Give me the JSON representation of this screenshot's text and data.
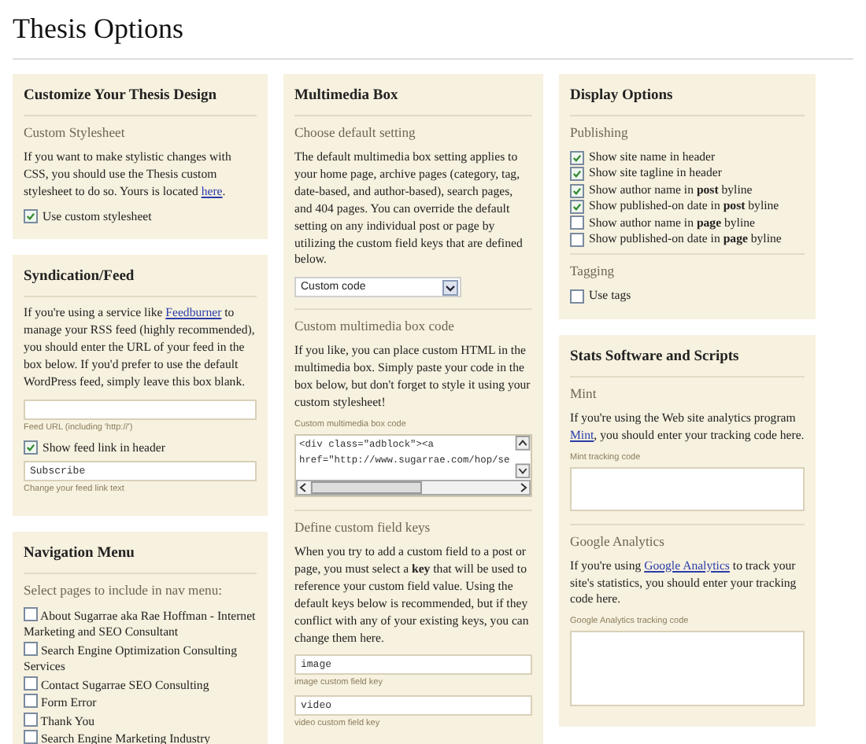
{
  "page_title": "Thesis Options",
  "columns": [
    [
      {
        "title": "Customize Your Thesis Design",
        "sections": [
          {
            "heading": "Custom Stylesheet",
            "items": [
              {
                "kind": "paragraph",
                "before": "If you want to make stylistic changes with CSS, you should use the Thesis custom stylesheet to do so. Yours is located ",
                "link": "here",
                "after": "."
              },
              {
                "kind": "checkbox",
                "label": "Use custom stylesheet",
                "checked": true
              }
            ]
          }
        ]
      },
      {
        "title": "Syndication/Feed",
        "sections": [
          {
            "items": [
              {
                "kind": "paragraph",
                "before": "If you're using a service like ",
                "link": "Feedburner",
                "after": " to manage your RSS feed (highly recommended), you should enter the URL of your feed in the box below. If you'd prefer to use the default WordPress feed, simply leave this box blank."
              },
              {
                "kind": "text_field",
                "caption": "Feed URL (including 'http://')"
              },
              {
                "kind": "checkbox",
                "label": "Show feed link in header",
                "checked": true
              },
              {
                "kind": "text_field",
                "value": "Subscribe",
                "caption": "Change your feed link text"
              }
            ]
          }
        ]
      },
      {
        "title": "Navigation Menu",
        "sections": [
          {
            "heading": "Select pages to include in nav menu:",
            "items": [
              {
                "kind": "wrapcheck",
                "label": "About Sugarrae aka Rae Hoffman - Internet Marketing and SEO Consultant",
                "checked": false
              },
              {
                "kind": "wrapcheck",
                "label": "Search Engine Optimization Consulting Services",
                "checked": false
              },
              {
                "kind": "wrapcheck",
                "label": "Contact Sugarrae SEO Consulting",
                "checked": false
              },
              {
                "kind": "wrapcheck",
                "label": "Form Error",
                "checked": false
              },
              {
                "kind": "wrapcheck",
                "label": "Thank You",
                "checked": false
              },
              {
                "kind": "wrapcheck",
                "label": "Search Engine Marketing Industry",
                "checked": false
              }
            ]
          }
        ]
      }
    ],
    [
      {
        "title": "Multimedia Box",
        "sections": [
          {
            "heading": "Choose default setting",
            "items": [
              {
                "kind": "paragraph",
                "text": "The default multimedia box setting applies to your home page, archive pages (category, tag, date-based, and author-based), search pages, and 404 pages. You can override the default setting on any individual post or page by utilizing the custom field keys that are defined below."
              },
              {
                "kind": "select",
                "value": "Custom code"
              }
            ]
          },
          {
            "heading": "Custom multimedia box code",
            "items": [
              {
                "kind": "paragraph",
                "text": "If you like, you can place custom HTML in the multimedia box. Simply paste your code in the box below, but don't forget to style it using your custom stylesheet!"
              },
              {
                "kind": "code_field",
                "caption": "Custom multimedia box code",
                "lines": [
                  "<div class=\"adblock\"><a",
                  "href=\"http://www.sugarrae.com/hop/se"
                ]
              }
            ]
          },
          {
            "heading": "Define custom field keys",
            "items": [
              {
                "kind": "paragraph",
                "text": "When you try to add a custom field to a post or page, you must select a **key** that will be used to reference your custom field value. Using the default keys below is recommended, but if they conflict with any of your existing keys, you can change them here."
              },
              {
                "kind": "text_field",
                "value": "image",
                "caption": "image custom field key"
              },
              {
                "kind": "text_field",
                "value": "video",
                "caption": "video custom field key"
              }
            ]
          }
        ]
      }
    ],
    [
      {
        "title": "Display Options",
        "sections": [
          {
            "heading": "Publishing",
            "items": [
              {
                "kind": "checkbox",
                "label": "Show site name in header",
                "checked": true
              },
              {
                "kind": "checkbox",
                "label": "Show site tagline in header",
                "checked": true
              },
              {
                "kind": "checkbox",
                "label": "Show author name in **post** byline",
                "checked": true
              },
              {
                "kind": "checkbox",
                "label": "Show published-on date in **post** byline",
                "checked": true
              },
              {
                "kind": "checkbox",
                "label": "Show author name in **page** byline",
                "checked": false
              },
              {
                "kind": "checkbox",
                "label": "Show published-on date in **page** byline",
                "checked": false
              }
            ]
          },
          {
            "heading": "Tagging",
            "items": [
              {
                "kind": "checkbox",
                "label": "Use tags",
                "checked": false
              }
            ]
          }
        ]
      },
      {
        "title": "Stats Software and Scripts",
        "sections": [
          {
            "heading": "Mint",
            "items": [
              {
                "kind": "paragraph",
                "before": "If you're using the Web site analytics program ",
                "link": "Mint",
                "after": ", you should enter your tracking code here."
              },
              {
                "kind": "textarea",
                "caption": "Mint tracking code"
              }
            ]
          },
          {
            "heading": "Google Analytics",
            "items": [
              {
                "kind": "paragraph",
                "before": "If you're using ",
                "link": "Google Analytics",
                "after": " to track your site's statistics, you should enter your tracking code here."
              },
              {
                "kind": "textarea",
                "caption": "Google Analytics tracking code"
              }
            ]
          }
        ]
      }
    ]
  ]
}
